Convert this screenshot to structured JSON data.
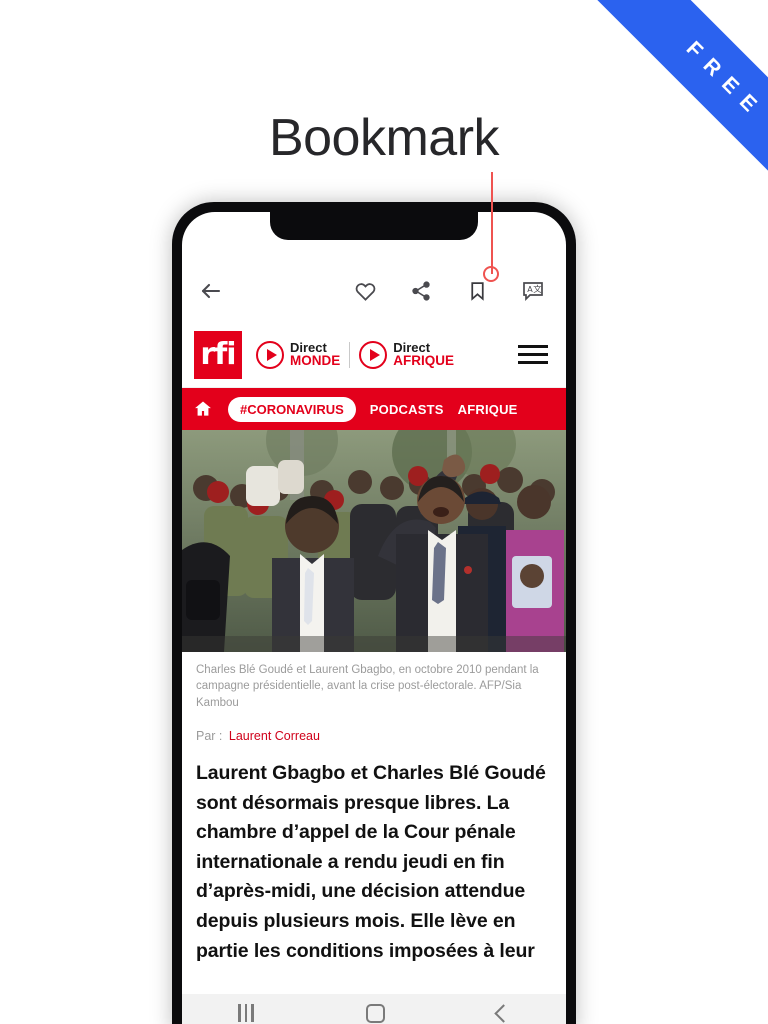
{
  "ribbon": {
    "label": "FREE",
    "color": "#2b62ef"
  },
  "headline": "Bookmark",
  "annotation": {
    "target": "bookmark-icon",
    "color": "#ef5350"
  },
  "app_toolbar": {
    "back_icon": "back-arrow-icon",
    "actions": [
      {
        "name": "favorite-icon",
        "label": "Favorite"
      },
      {
        "name": "share-icon",
        "label": "Share"
      },
      {
        "name": "bookmark-icon",
        "label": "Bookmark"
      },
      {
        "name": "translate-icon",
        "label": "Translate"
      }
    ]
  },
  "site_header": {
    "logo_text": "rfi",
    "logo_color": "#e3001b",
    "live_monde": {
      "line1": "Direct",
      "line2": "MONDE"
    },
    "live_afrique": {
      "line1": "Direct",
      "line2": "AFRIQUE"
    },
    "menu_icon": "hamburger-menu-icon"
  },
  "nav": {
    "home_icon": "home-icon",
    "items": [
      {
        "label": "#CORONAVIRUS",
        "active": true
      },
      {
        "label": "PODCASTS",
        "active": false
      },
      {
        "label": "AFRIQUE",
        "active": false
      }
    ],
    "background": "#e3001b"
  },
  "article": {
    "caption": "Charles Blé Goudé et Laurent Gbagbo, en octobre 2010 pendant la campagne présidentielle, avant la crise post-électorale. AFP/Sia Kambou",
    "byline_prefix": "Par :",
    "author": "Laurent Correau",
    "lead": "Laurent Gbagbo et Charles Blé Goudé sont désormais presque libres. La chambre d’appel de la Cour pénale internationale a rendu jeudi en fin d’après-midi, une décision attendue depuis plusieurs mois. Elle lève en partie les conditions imposées à leur"
  },
  "android_nav": {
    "recents": "recents-button",
    "home": "home-button",
    "back": "back-button"
  }
}
